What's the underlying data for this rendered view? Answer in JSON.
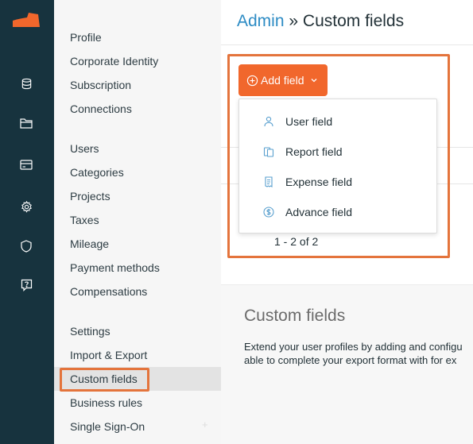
{
  "rail": {
    "icons": [
      "logo-icon",
      "database-icon",
      "folder-icon",
      "card-icon",
      "gear-icon",
      "shield-icon",
      "help-icon"
    ]
  },
  "subnav": {
    "groups": [
      [
        "Profile",
        "Corporate Identity",
        "Subscription",
        "Connections"
      ],
      [
        "Users",
        "Categories",
        "Projects",
        "Taxes",
        "Mileage",
        "Payment methods",
        "Compensations"
      ],
      [
        "Settings",
        "Import & Export",
        "Custom fields",
        "Business rules",
        "Single Sign-On"
      ]
    ],
    "active": "Custom fields"
  },
  "header": {
    "breadcrumb": "Admin",
    "separator": "»",
    "title": "Custom fields"
  },
  "add_button": {
    "label": "Add field",
    "icon": "plus-circle-icon",
    "caret": "chevron-down-icon"
  },
  "dropdown": {
    "items": [
      {
        "label": "User field",
        "icon": "user-icon"
      },
      {
        "label": "Report field",
        "icon": "report-icon"
      },
      {
        "label": "Expense field",
        "icon": "receipt-icon"
      },
      {
        "label": "Advance field",
        "icon": "dollar-circle-icon"
      }
    ]
  },
  "pagination": {
    "text": "1 - 2 of 2"
  },
  "info": {
    "title": "Custom fields",
    "line1": "Extend your user profiles by adding and configu",
    "line2": "able to complete your export format with for ex"
  },
  "colors": {
    "rail": "#17333e",
    "accent": "#f1672c",
    "highlight": "#e4743c",
    "link": "#2c8bc4",
    "icon_blue": "#5aa0cf"
  }
}
